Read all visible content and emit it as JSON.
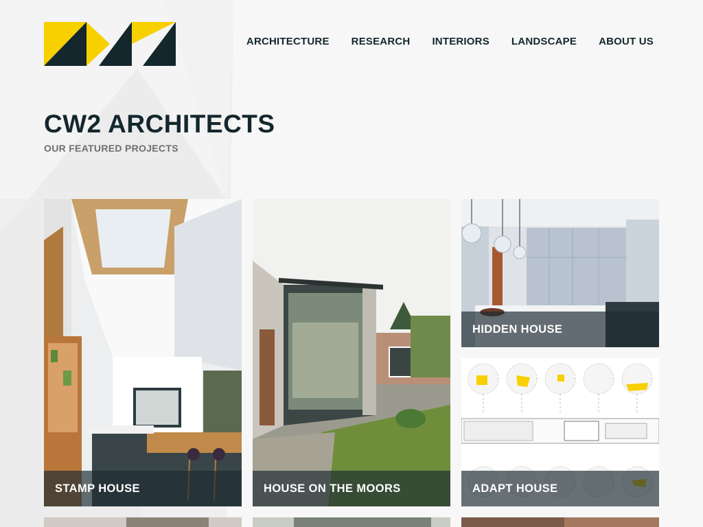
{
  "brand": {
    "logo_name": "CW2 Architects logo",
    "colors": {
      "yellow": "#f7d000",
      "dark": "#13272d",
      "background": "#f7f7f7"
    }
  },
  "nav": {
    "items": [
      {
        "label": "ARCHITECTURE"
      },
      {
        "label": "RESEARCH"
      },
      {
        "label": "INTERIORS"
      },
      {
        "label": "LANDSCAPE"
      },
      {
        "label": "ABOUT US"
      }
    ]
  },
  "hero": {
    "title": "CW2 ARCHITECTS",
    "subtitle": "OUR FEATURED PROJECTS"
  },
  "projects": [
    {
      "title": "STAMP HOUSE"
    },
    {
      "title": "HOUSE ON THE MOORS"
    },
    {
      "title": "HIDDEN HOUSE"
    },
    {
      "title": "ADAPT HOUSE"
    }
  ]
}
